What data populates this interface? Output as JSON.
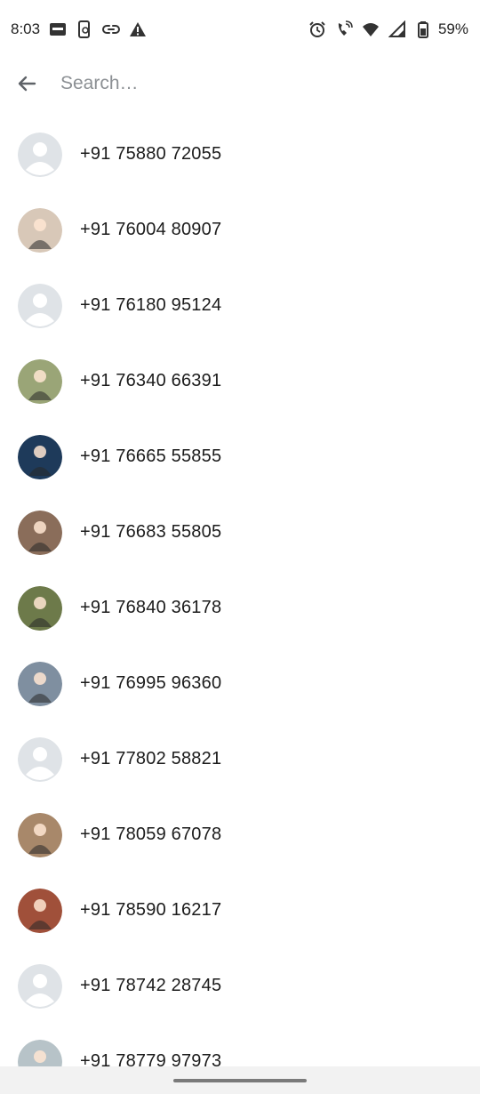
{
  "status_bar": {
    "time": "8:03",
    "battery": "59%",
    "left_icons": [
      "news-app-icon",
      "phone-sync-icon",
      "link-icon",
      "warning-icon"
    ],
    "right_icons": [
      "alarm-icon",
      "wifi-calling-icon",
      "wifi-icon",
      "cellular-signal-icon",
      "battery-icon"
    ]
  },
  "search": {
    "placeholder": "Search…",
    "value": ""
  },
  "contacts": [
    {
      "number": "+91 75880 72055",
      "avatar": "default",
      "color": "#c9cdd2"
    },
    {
      "number": "+91 76004 80907",
      "avatar": "photo",
      "color": "#d8c8b8"
    },
    {
      "number": "+91 76180 95124",
      "avatar": "default",
      "color": "#c9cdd2"
    },
    {
      "number": "+91 76340 66391",
      "avatar": "photo",
      "color": "#9aa577"
    },
    {
      "number": "+91 76665 55855",
      "avatar": "photo",
      "color": "#1e3a5a"
    },
    {
      "number": "+91 76683 55805",
      "avatar": "photo",
      "color": "#8a6d5a"
    },
    {
      "number": "+91 76840 36178",
      "avatar": "photo",
      "color": "#6d7a4a"
    },
    {
      "number": "+91 76995 96360",
      "avatar": "photo",
      "color": "#7f8fa0"
    },
    {
      "number": "+91 77802 58821",
      "avatar": "default",
      "color": "#c9cdd2"
    },
    {
      "number": "+91 78059 67078",
      "avatar": "photo",
      "color": "#a8886a"
    },
    {
      "number": "+91 78590 16217",
      "avatar": "photo",
      "color": "#a0503a"
    },
    {
      "number": "+91 78742 28745",
      "avatar": "default",
      "color": "#c9cdd2"
    },
    {
      "number": "+91 78779 97973",
      "avatar": "photo",
      "color": "#b7c3c8"
    }
  ]
}
